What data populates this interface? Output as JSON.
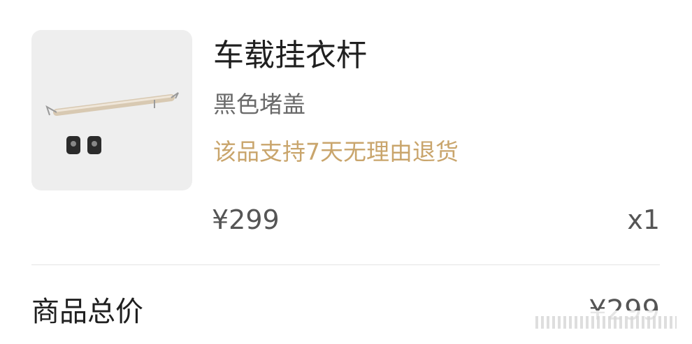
{
  "item": {
    "thumbnail_icon": "hanger-rod-with-clips",
    "title": "车载挂衣杆",
    "variant": "黑色堵盖",
    "return_policy": "该品支持7天无理由退货",
    "price": "¥299",
    "quantity": "x1"
  },
  "summary": {
    "total_label": "商品总价",
    "total_value": "¥299"
  },
  "colors": {
    "return_policy": "#c9a56c",
    "thumbnail_bg": "#eeeeee"
  }
}
